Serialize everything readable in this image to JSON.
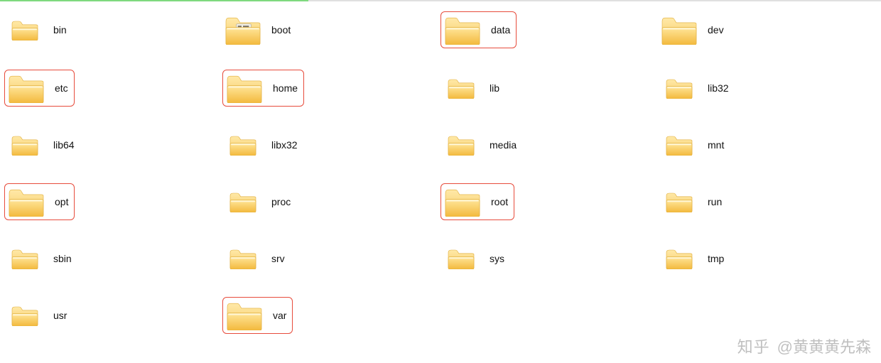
{
  "folders": [
    {
      "name": "bin",
      "variant": "small",
      "highlighted": false
    },
    {
      "name": "boot",
      "variant": "config",
      "highlighted": false
    },
    {
      "name": "data",
      "variant": "large",
      "highlighted": true
    },
    {
      "name": "dev",
      "variant": "doc",
      "highlighted": false
    },
    {
      "name": "etc",
      "variant": "doc",
      "highlighted": true
    },
    {
      "name": "home",
      "variant": "large",
      "highlighted": true
    },
    {
      "name": "lib",
      "variant": "small",
      "highlighted": false
    },
    {
      "name": "lib32",
      "variant": "small",
      "highlighted": false
    },
    {
      "name": "lib64",
      "variant": "small",
      "highlighted": false
    },
    {
      "name": "libx32",
      "variant": "small",
      "highlighted": false
    },
    {
      "name": "media",
      "variant": "small",
      "highlighted": false
    },
    {
      "name": "mnt",
      "variant": "small",
      "highlighted": false
    },
    {
      "name": "opt",
      "variant": "large",
      "highlighted": true
    },
    {
      "name": "proc",
      "variant": "small",
      "highlighted": false
    },
    {
      "name": "root",
      "variant": "large",
      "highlighted": true
    },
    {
      "name": "run",
      "variant": "small",
      "highlighted": false
    },
    {
      "name": "sbin",
      "variant": "small",
      "highlighted": false
    },
    {
      "name": "srv",
      "variant": "small",
      "highlighted": false
    },
    {
      "name": "sys",
      "variant": "small",
      "highlighted": false
    },
    {
      "name": "tmp",
      "variant": "small",
      "highlighted": false
    },
    {
      "name": "usr",
      "variant": "small",
      "highlighted": false
    },
    {
      "name": "var",
      "variant": "large",
      "highlighted": true
    }
  ],
  "watermark": {
    "site": "知乎",
    "author": "@黄黄黄先森"
  },
  "colors": {
    "highlight_border": "#e74c3c",
    "folder_light": "#ffe9a8",
    "folder_dark": "#f8c24a"
  }
}
